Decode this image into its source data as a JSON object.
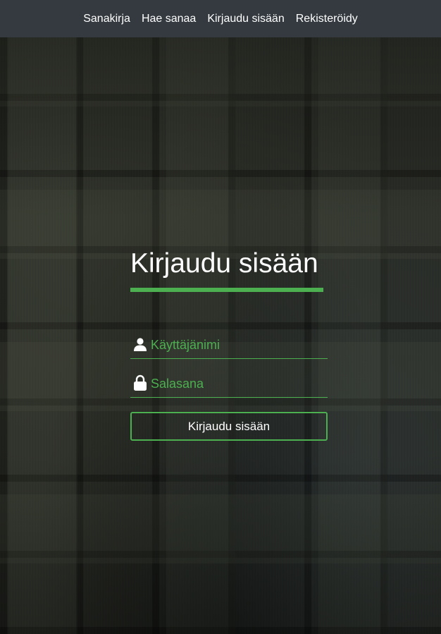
{
  "nav": {
    "items": [
      {
        "label": "Sanakirja"
      },
      {
        "label": "Hae sanaa"
      },
      {
        "label": "Kirjaudu sisään"
      },
      {
        "label": "Rekisteröidy"
      }
    ]
  },
  "login": {
    "title": "Kirjaudu sisään",
    "username": {
      "placeholder": "Käyttäjänimi",
      "value": ""
    },
    "password": {
      "placeholder": "Salasana",
      "value": ""
    },
    "submit_label": "Kirjaudu sisään"
  },
  "colors": {
    "navbar": "#343a40",
    "accent": "#4caf50",
    "text": "#ffffff"
  },
  "icons": {
    "username": "user-icon",
    "password": "lock-icon"
  }
}
